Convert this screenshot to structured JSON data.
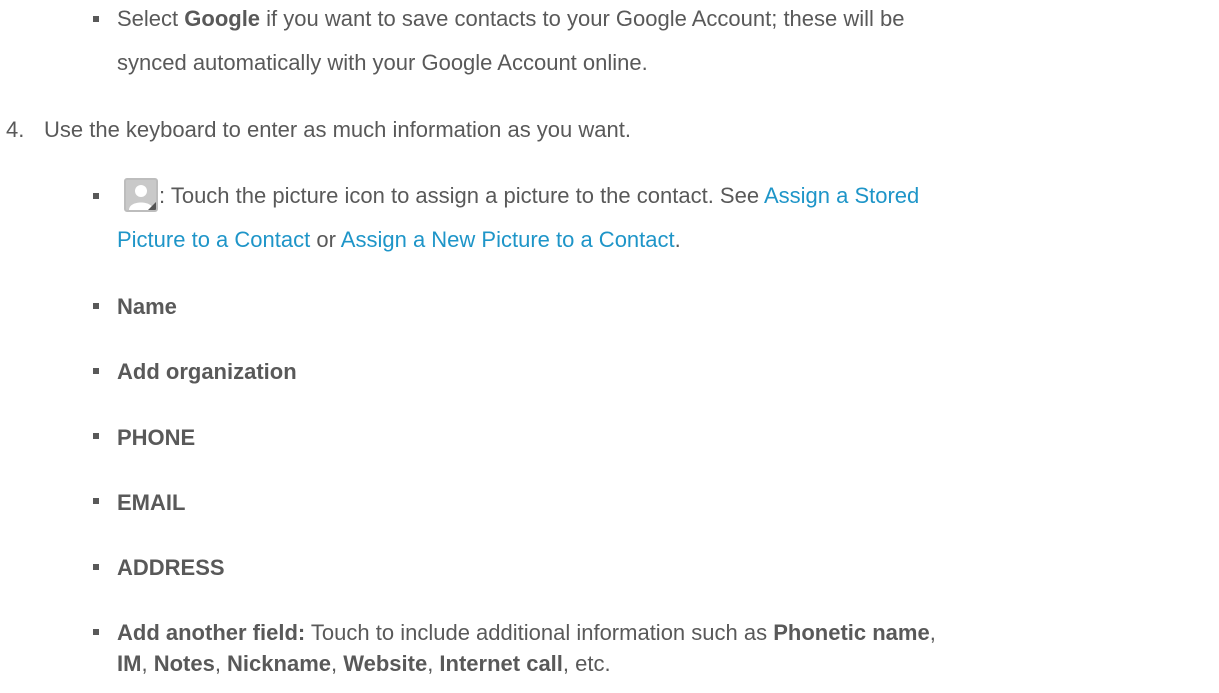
{
  "intro_bullet": {
    "line1_pre": "Select ",
    "line1_bold": "Google",
    "line1_post": " if you want to save contacts to your Google Account; these will be",
    "line2": "synced automatically with your Google Account online."
  },
  "step4": {
    "number": "4.",
    "text": "Use the keyboard to enter as much information as you want."
  },
  "picture_bullet": {
    "icon": "contact-picture-icon",
    "line1_text": ": Touch the picture icon to assign a picture to the contact. See ",
    "link1_part1": "Assign a Stored",
    "link1_part2": "Picture to a Contact",
    "or_text": " or ",
    "link2": "Assign a New Picture to a Contact",
    "period": "."
  },
  "fields": [
    "Name",
    "Add organization",
    "PHONE",
    "EMAIL",
    "ADDRESS"
  ],
  "another_field": {
    "bold_label": "Add another field:",
    "line1_text": " Touch to include additional information such as ",
    "phonetic": "Phonetic name",
    "comma1": ",",
    "im": "IM",
    "comma2": ", ",
    "notes": "Notes",
    "comma3": ", ",
    "nickname": "Nickname",
    "comma4": ", ",
    "website": "Website",
    "comma5": ", ",
    "internet_call": "Internet call",
    "etc": ", etc."
  },
  "colors": {
    "text": "#595959",
    "link": "#1e95c8"
  }
}
